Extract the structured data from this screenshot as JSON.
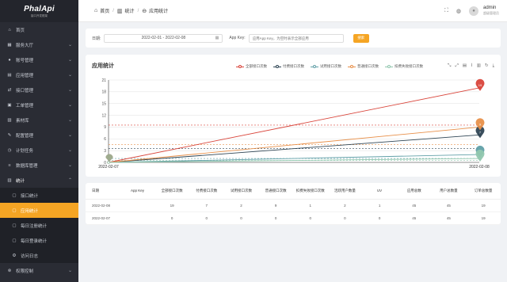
{
  "app": {
    "logo": "PhalApi",
    "logo_sub": "接口开发框架"
  },
  "sidebar": {
    "items": [
      {
        "icon": "home-icon",
        "glyph": "⌂",
        "label": "首页",
        "arrow": ""
      },
      {
        "icon": "grid-icon",
        "glyph": "▦",
        "label": "服务大厅",
        "arrow": "⌄"
      },
      {
        "icon": "user-icon",
        "glyph": "●",
        "label": "账号管理",
        "arrow": "⌄"
      },
      {
        "icon": "app-icon",
        "glyph": "▤",
        "label": "应用管理",
        "arrow": "⌄"
      },
      {
        "icon": "api-icon",
        "glyph": "⇄",
        "label": "接口管理",
        "arrow": "⌄"
      },
      {
        "icon": "ticket-icon",
        "glyph": "▣",
        "label": "工单管理",
        "arrow": "⌄"
      },
      {
        "icon": "image-icon",
        "glyph": "▧",
        "label": "素材库",
        "arrow": "⌄"
      },
      {
        "icon": "wrench-icon",
        "glyph": "✎",
        "label": "配置管理",
        "arrow": "⌄"
      },
      {
        "icon": "clock-icon",
        "glyph": "◷",
        "label": "计划任务",
        "arrow": "⌄"
      },
      {
        "icon": "database-icon",
        "glyph": "≡",
        "label": "数据库管理",
        "arrow": "⌄"
      },
      {
        "icon": "chart-icon",
        "glyph": "▥",
        "label": "统计",
        "arrow": "⌃"
      }
    ],
    "sub_items": [
      {
        "icon": "doc-icon",
        "glyph": "▢",
        "label": "接口统计"
      },
      {
        "icon": "doc-icon",
        "glyph": "▢",
        "label": "应用统计"
      },
      {
        "icon": "doc-icon",
        "glyph": "▢",
        "label": "每日注册统计"
      },
      {
        "icon": "doc-icon",
        "glyph": "▢",
        "label": "每日登录统计"
      },
      {
        "icon": "gear-icon",
        "glyph": "⚙",
        "label": "访问日志"
      }
    ],
    "last_item": {
      "icon": "lock-icon",
      "glyph": "⊗",
      "label": "权限控制",
      "arrow": "⌄"
    }
  },
  "header": {
    "breadcrumb": [
      "首页",
      "统计",
      "应用统计"
    ],
    "user_name": "admin",
    "user_role": "超级管理员"
  },
  "filter": {
    "date_label": "日期:",
    "date_value": "2022-02-01 - 2022-02-08",
    "appkey_label": "App Key:",
    "appkey_placeholder": "应用App Key，为空时表示全部应用",
    "search_button": "搜索"
  },
  "colors": {
    "accent": "#f5a524",
    "sidebar_bg": "#2a2c34",
    "series": [
      "#d9453b",
      "#2f4554",
      "#61a0a8",
      "#e8904a",
      "#91c7ae"
    ]
  },
  "chart_data": {
    "type": "line",
    "title": "应用统计",
    "x": [
      "2022-02-07",
      "2022-02-08"
    ],
    "ylim": [
      0,
      21
    ],
    "yticks": [
      0,
      3,
      6,
      9,
      12,
      15,
      18,
      21
    ],
    "series": [
      {
        "name": "全部接口次数",
        "values": [
          0,
          19
        ]
      },
      {
        "name": "付费接口次数",
        "values": [
          0,
          7
        ]
      },
      {
        "name": "试用接口次数",
        "values": [
          0,
          2
        ]
      },
      {
        "name": "普通接口次数",
        "values": [
          0,
          9
        ]
      },
      {
        "name": "扣费失败接口次数",
        "values": [
          0,
          1
        ]
      }
    ],
    "markers": [
      "19",
      "9",
      "7",
      "2"
    ],
    "legend_position": "top-center",
    "grid": true
  },
  "table": {
    "headers": [
      "日期",
      "App Key",
      "全部接口次数",
      "付费接口次数",
      "试用接口次数",
      "普通接口次数",
      "扣费失败接口次数",
      "活跃用户数量",
      "UV",
      "应用总数",
      "用户总数量",
      "订单总数量"
    ],
    "rows": [
      [
        "2022-02-08",
        "",
        "19",
        "7",
        "2",
        "9",
        "1",
        "2",
        "1",
        "45",
        "45",
        "19"
      ],
      [
        "2022-02-07",
        "",
        "0",
        "0",
        "0",
        "0",
        "0",
        "0",
        "0",
        "45",
        "45",
        "19"
      ]
    ]
  }
}
